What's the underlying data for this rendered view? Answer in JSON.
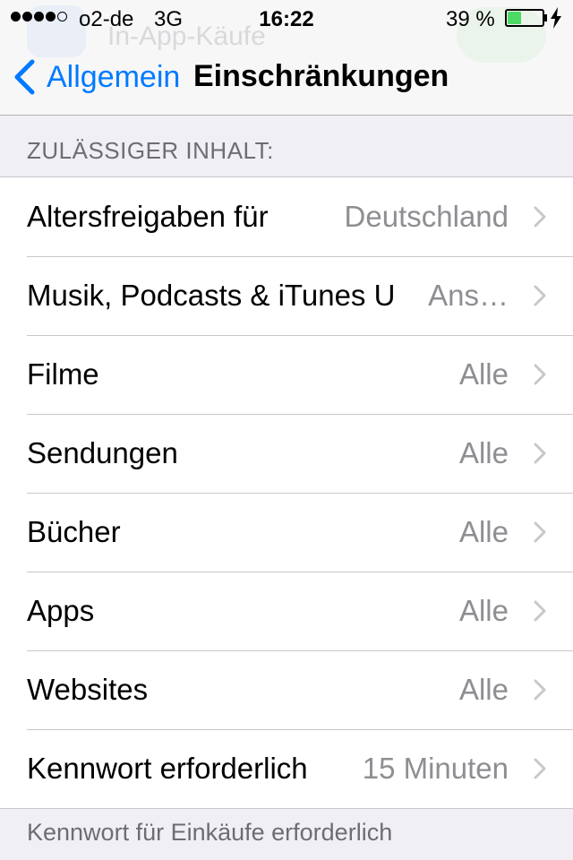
{
  "status_bar": {
    "carrier": "o2-de",
    "network": "3G",
    "time": "16:22",
    "battery_text": "39 %",
    "battery_percent": 39,
    "signal_bars_filled": 4,
    "signal_bars_total": 5
  },
  "background_ghost": {
    "text": "In-App-Käufe"
  },
  "nav": {
    "back_label": "Allgemein",
    "title": "Einschränkungen"
  },
  "section": {
    "header": "ZULÄSSIGER INHALT:"
  },
  "rows": [
    {
      "label": "Altersfreigaben für",
      "value": "Deutschland"
    },
    {
      "label": "Musik, Podcasts & iTunes U",
      "value": "Ans…"
    },
    {
      "label": "Filme",
      "value": "Alle"
    },
    {
      "label": "Sendungen",
      "value": "Alle"
    },
    {
      "label": "Bücher",
      "value": "Alle"
    },
    {
      "label": "Apps",
      "value": "Alle"
    },
    {
      "label": "Websites",
      "value": "Alle"
    },
    {
      "label": "Kennwort erforderlich",
      "value": "15 Minuten"
    }
  ],
  "footer": {
    "text": "Kennwort für Einkäufe erforderlich"
  },
  "colors": {
    "accent": "#007aff",
    "battery": "#4cd964",
    "background": "#efeff4",
    "secondary_text": "#8e8e93"
  },
  "icons": {
    "back": "chevron-left-icon",
    "row_disclosure": "chevron-right-icon",
    "charging": "lightning-bolt-icon"
  }
}
